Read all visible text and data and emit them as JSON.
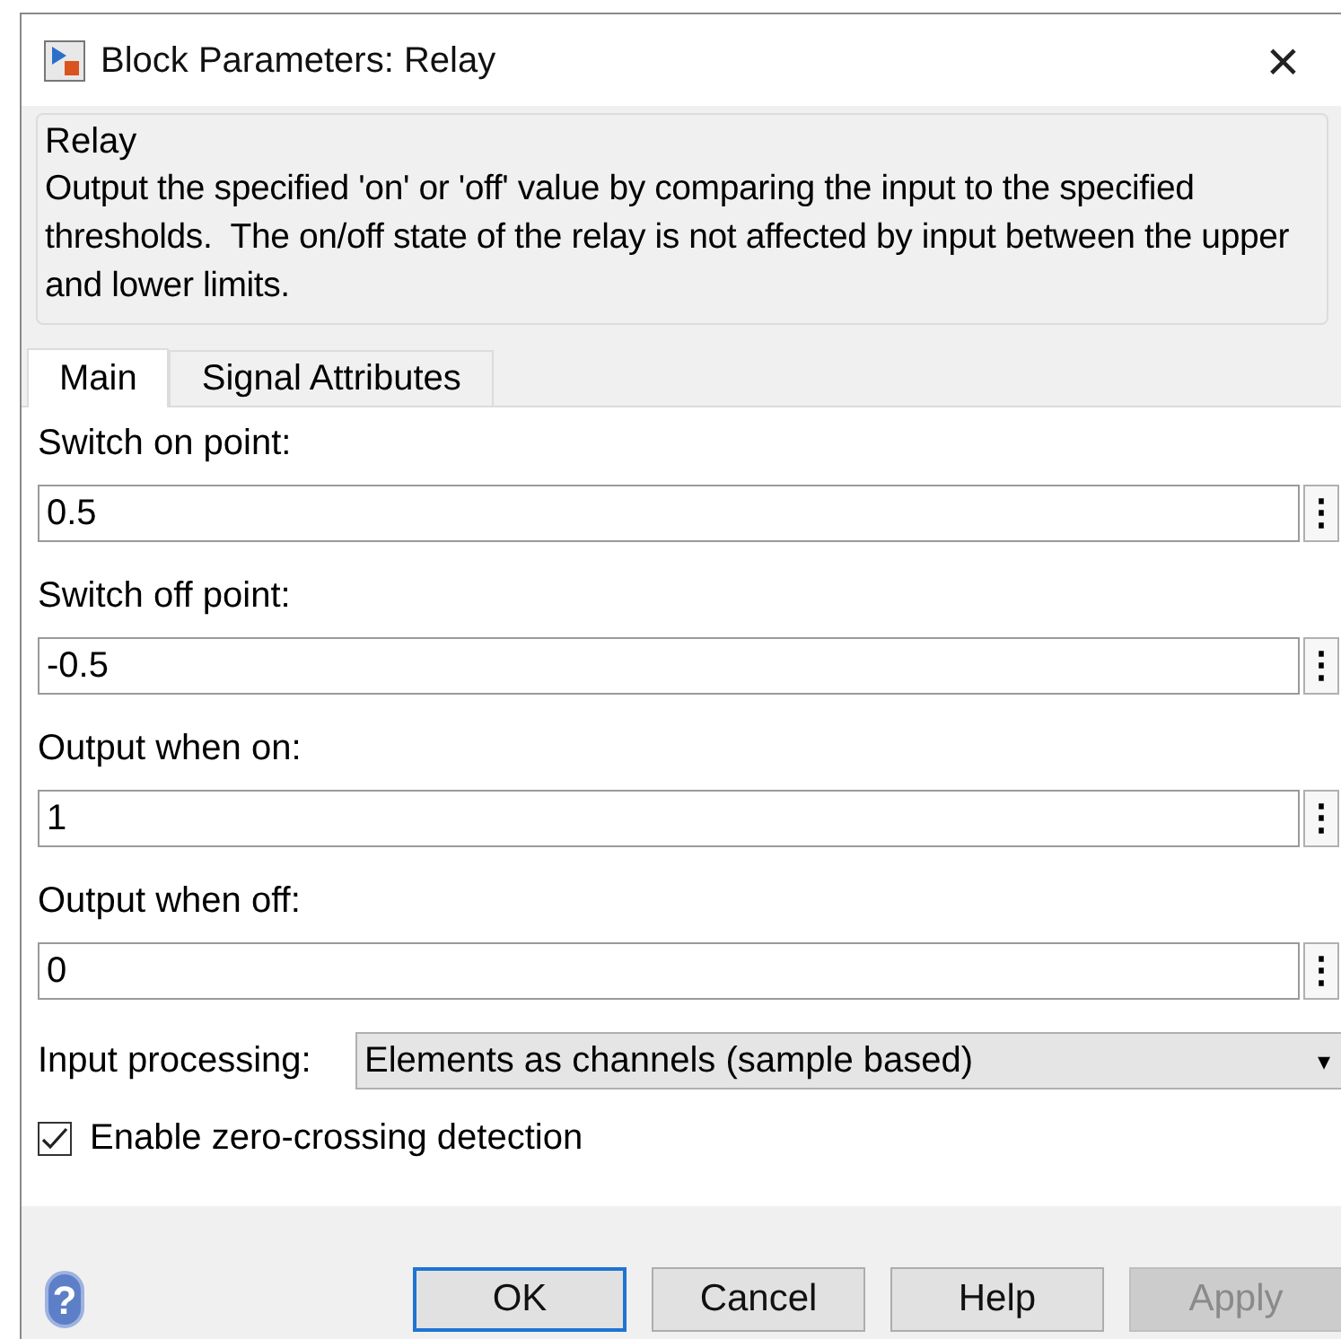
{
  "window": {
    "title": "Block Parameters: Relay",
    "close_glyph": "×"
  },
  "description": {
    "title": "Relay",
    "text": "Output the specified 'on' or 'off' value by comparing the input to the specified thresholds.  The on/off state of the relay is not affected by input between the upper and lower limits."
  },
  "tabs": [
    {
      "label": "Main",
      "selected": true
    },
    {
      "label": "Signal Attributes",
      "selected": false
    }
  ],
  "parameters": [
    {
      "label": "Switch on point:",
      "value": "0.5",
      "menu_glyph": "⋮"
    },
    {
      "label": "Switch off point:",
      "value": "-0.5",
      "menu_glyph": "⋮"
    },
    {
      "label": "Output when on:",
      "value": "1",
      "menu_glyph": "⋮"
    },
    {
      "label": "Output when off:",
      "value": "0",
      "menu_glyph": "⋮"
    }
  ],
  "input_processing": {
    "label": "Input processing:",
    "value": "Elements as channels (sample based)",
    "caret": "▾"
  },
  "zero_crossing": {
    "label": "Enable zero-crossing detection",
    "checked": true
  },
  "help_icon": "?",
  "buttons": [
    {
      "label": "OK",
      "disabled": false,
      "default": true
    },
    {
      "label": "Cancel",
      "disabled": false,
      "default": false
    },
    {
      "label": "Help",
      "disabled": false,
      "default": false
    },
    {
      "label": "Apply",
      "disabled": true,
      "default": false
    }
  ]
}
